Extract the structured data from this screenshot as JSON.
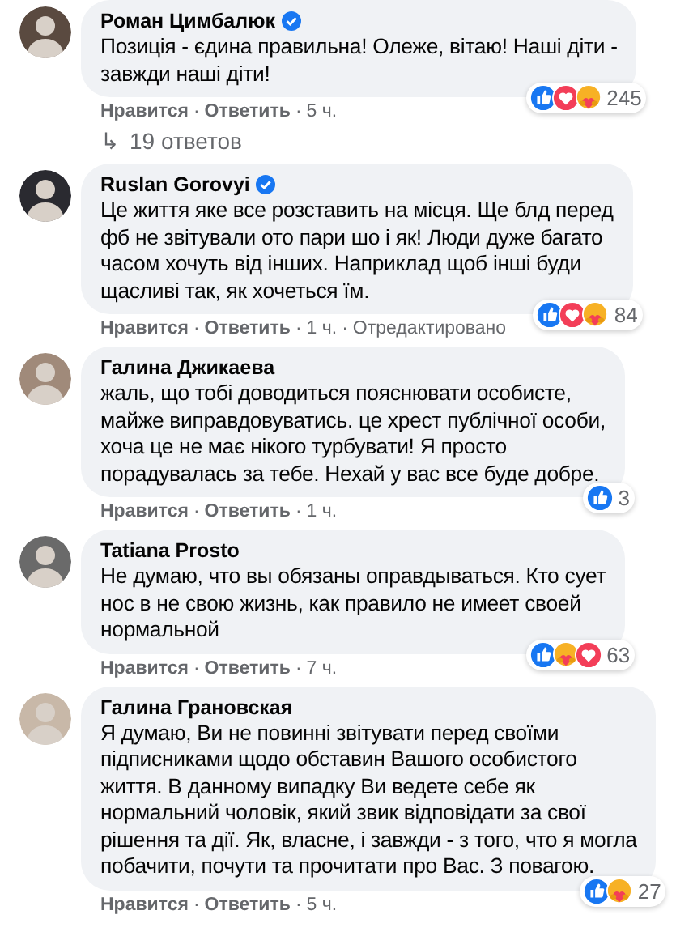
{
  "separator": "·",
  "comments": [
    {
      "author": "Роман Цимбалюк",
      "verified": true,
      "text": "Позиція - єдина правильна! Олеже, вітаю! Наші діти -\nзавжди наші діти!",
      "reactions": [
        {
          "kind": "like"
        },
        {
          "kind": "love"
        },
        {
          "kind": "care"
        }
      ],
      "reaction_count": "245",
      "meta": [
        {
          "kind": "action",
          "label": "Нравится"
        },
        {
          "kind": "action",
          "label": "Ответить"
        },
        {
          "kind": "time",
          "label": "5 ч."
        }
      ],
      "replies": "19 ответов",
      "replies_icon": "↳"
    },
    {
      "author": "Ruslan Gorovyi",
      "verified": true,
      "text": "Це життя яке все розставить на місця. Ще блд перед\nфб не звітували ото пари шо і як! Люди дуже багато\nчасом хочуть від інших. Наприклад щоб інші буди\nщасливі так, як хочеться їм.",
      "reactions": [
        {
          "kind": "like"
        },
        {
          "kind": "love"
        },
        {
          "kind": "care"
        }
      ],
      "reaction_count": "84",
      "meta": [
        {
          "kind": "action",
          "label": "Нравится"
        },
        {
          "kind": "action",
          "label": "Ответить"
        },
        {
          "kind": "time",
          "label": "1 ч."
        },
        {
          "kind": "note",
          "label": "Отредактировано"
        }
      ]
    },
    {
      "author": "Галина Джикаева",
      "verified": false,
      "text": "жаль, що тобі доводиться пояснювати особисте,\nмайже виправдовуватись. це хрест публічної особи,\nхоча це не має нікого турбувати! Я просто\nпорадувалась за тебе. Нехай у вас все буде добре.",
      "reactions": [
        {
          "kind": "like"
        }
      ],
      "reaction_count": "3",
      "meta": [
        {
          "kind": "action",
          "label": "Нравится"
        },
        {
          "kind": "action",
          "label": "Ответить"
        },
        {
          "kind": "time",
          "label": "1 ч."
        }
      ]
    },
    {
      "author": "Tatiana Prosto",
      "verified": false,
      "text": "Не думаю, что вы обязаны оправдываться. Кто сует\nнос в не свою жизнь, как правило не имеет своей\nнормальной",
      "reactions": [
        {
          "kind": "like"
        },
        {
          "kind": "care"
        },
        {
          "kind": "love"
        }
      ],
      "reaction_count": "63",
      "meta": [
        {
          "kind": "action",
          "label": "Нравится"
        },
        {
          "kind": "action",
          "label": "Ответить"
        },
        {
          "kind": "time",
          "label": "7 ч."
        }
      ]
    },
    {
      "author": "Галина Грановская",
      "verified": false,
      "text": "Я думаю, Ви не повинні звітувати перед своїми\nпідписниками щодо обставин Вашого особистого\nжиття. В данному випадку Ви ведете себе як\nнормальний чоловік, який звик відповідати за свої\nрішення та дії. Як, власне, і завжди - з того, что я могла\nпобачити, почути та прочитати про Вас. З повагою.",
      "reactions": [
        {
          "kind": "like"
        },
        {
          "kind": "care"
        }
      ],
      "reaction_count": "27",
      "meta": [
        {
          "kind": "action",
          "label": "Нравится"
        },
        {
          "kind": "action",
          "label": "Ответить"
        },
        {
          "kind": "time",
          "label": "5 ч."
        }
      ]
    }
  ]
}
